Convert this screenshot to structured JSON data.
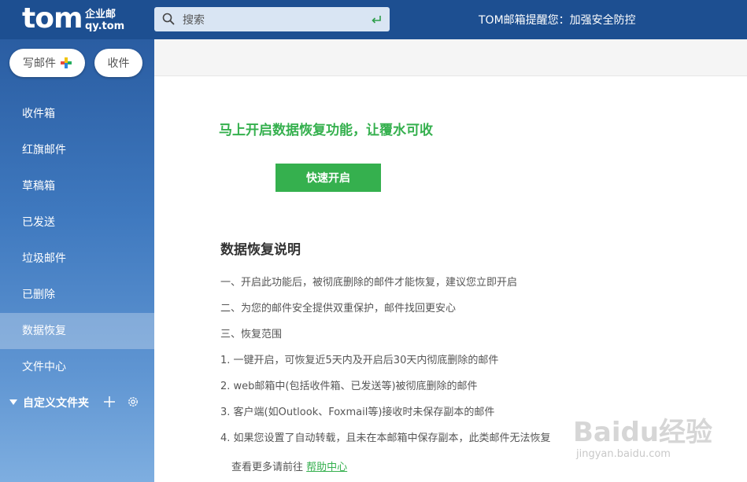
{
  "header": {
    "logo": "tom",
    "logo_sub1": "企业邮",
    "logo_sub2": "qy.tom",
    "search_placeholder": "搜索",
    "notice": "TOM邮箱提醒您：加强安全防控"
  },
  "sidebar": {
    "compose_label": "写邮件",
    "receive_label": "收件",
    "items": [
      {
        "label": "收件箱"
      },
      {
        "label": "红旗邮件"
      },
      {
        "label": "草稿箱"
      },
      {
        "label": "已发送"
      },
      {
        "label": "垃圾邮件"
      },
      {
        "label": "已删除"
      },
      {
        "label": "数据恢复",
        "active": true
      },
      {
        "label": "文件中心"
      }
    ],
    "custom_folder_label": "自定义文件夹"
  },
  "main": {
    "promo_title": "马上开启数据恢复功能，让覆水可收",
    "enable_button": "快速开启",
    "section_title": "数据恢复说明",
    "lines": [
      "一、开启此功能后，被彻底删除的邮件才能恢复，建议您立即开启",
      "二、为您的邮件安全提供双重保护，邮件找回更安心",
      "三、恢复范围",
      "1. 一键开启，可恢复近5天内及开启后30天内彻底删除的邮件",
      "2. web邮箱中(包括收件箱、已发送等)被彻底删除的邮件",
      "3. 客户端(如Outlook、Foxmail等)接收时未保存副本的邮件",
      "4. 如果您设置了自动转载，且未在本邮箱中保存副本，此类邮件无法恢复"
    ],
    "more_prefix": "查看更多请前往",
    "help_link": "帮助中心"
  },
  "watermark": {
    "brand": "Baidu经验",
    "url": "jingyan.baidu.com"
  },
  "colors": {
    "header_bg": "#1d4f91",
    "accent_green": "#35b04e",
    "sidebar_top": "#2a5da2",
    "sidebar_bottom": "#7eaee0"
  }
}
